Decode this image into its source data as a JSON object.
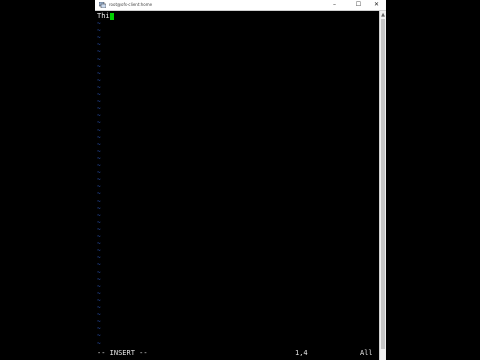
{
  "window": {
    "title": "root@ofs-client:home",
    "controls": {
      "minimize": "–",
      "maximize": "☐",
      "close": "✕"
    }
  },
  "editor": {
    "typed_text": "Thi",
    "empty_line_marker": "~",
    "status": {
      "mode": "-- INSERT --",
      "position": "1,4",
      "scroll": "All"
    }
  },
  "colors": {
    "cursor": "#00d000",
    "tilde": "#2f5fd0",
    "background": "#000000"
  }
}
